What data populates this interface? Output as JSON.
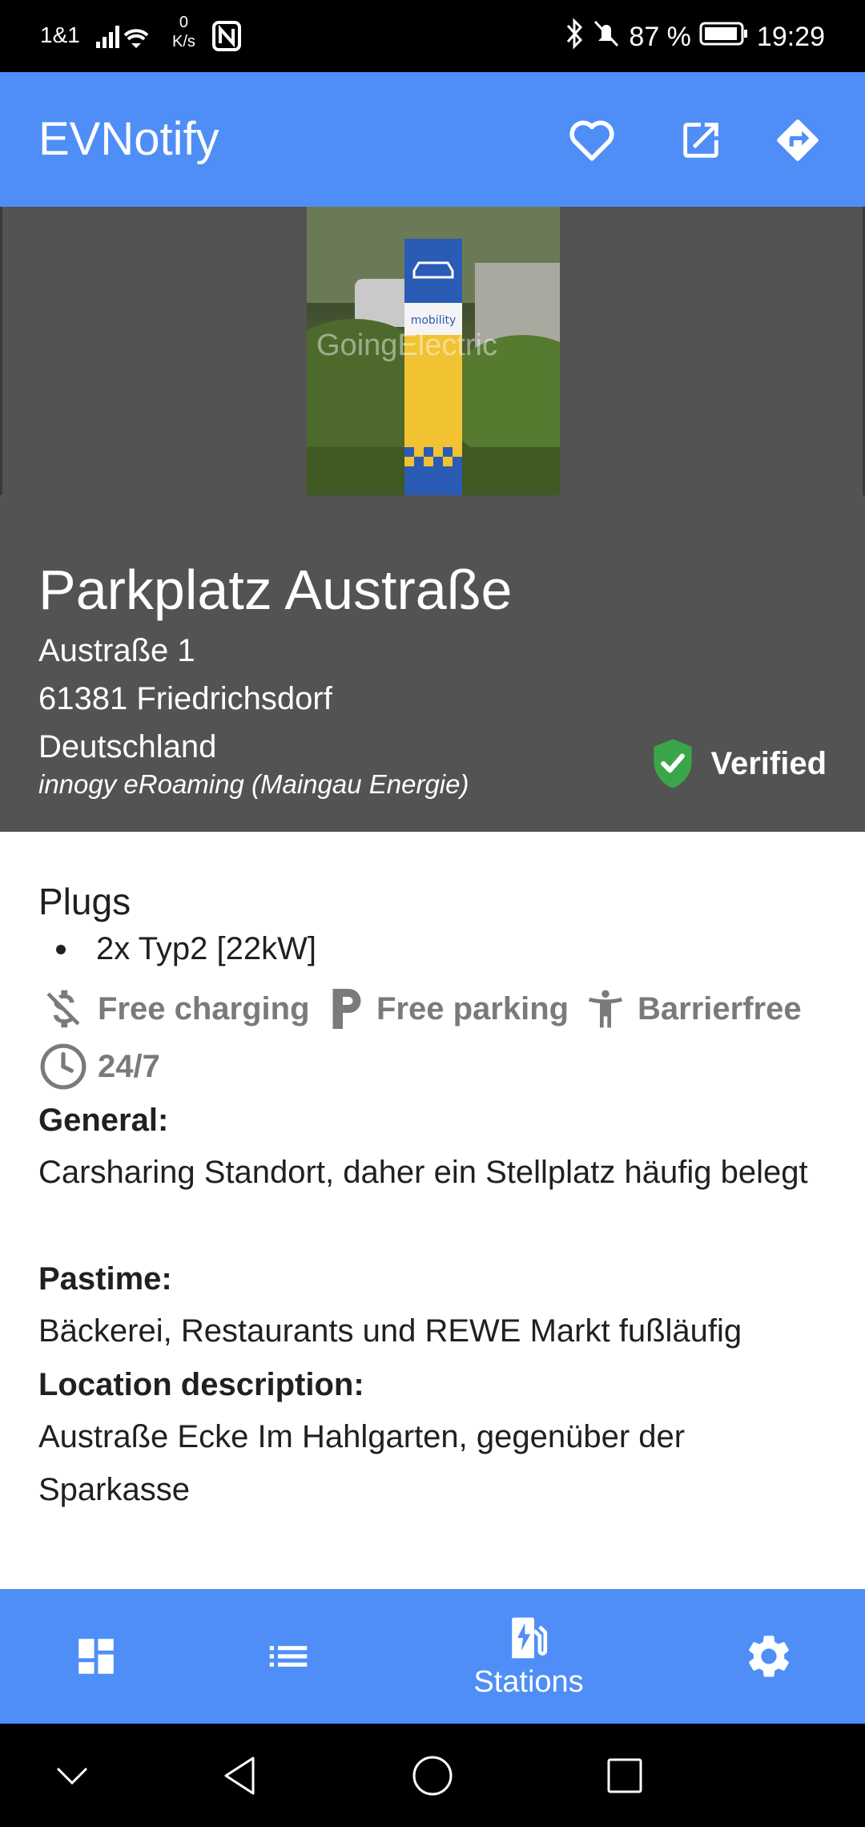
{
  "status_bar": {
    "carrier": "1&1",
    "net_speed_value": "0",
    "net_speed_unit": "K/s",
    "battery": "87 %",
    "time": "19:29"
  },
  "app_bar": {
    "title": "EVNotify",
    "actions": [
      "heart-icon",
      "open-external-icon",
      "directions-icon"
    ]
  },
  "hero": {
    "photo_watermark": "GoingElectric",
    "station_name": "Parkplatz Austraße",
    "address_line1": "Austraße 1",
    "address_line2": "61381 Friedrichsdorf",
    "address_line3": "Deutschland",
    "operator": "innogy eRoaming (Maingau Energie)",
    "verified_label": "Verified",
    "colors": {
      "background": "#535353",
      "verified_shield": "#3aa64a"
    }
  },
  "details": {
    "plugs_title": "Plugs",
    "plugs": [
      "2x Typ2 [22kW]"
    ],
    "features": {
      "free_charging": "Free charging",
      "free_parking": "Free parking",
      "barrierfree": "Barrierfree",
      "open_hours": "24/7"
    },
    "general_label": "General:",
    "general_text": "Carsharing Standort, daher ein Stellplatz häufig belegt",
    "pastime_label": "Pastime:",
    "pastime_text": "Bäckerei, Restaurants und REWE Markt fußläufig",
    "location_label": "Location description:",
    "location_text": "Austraße Ecke Im Hahlgarten, gegenüber der Sparkasse"
  },
  "bottom_nav": {
    "items": [
      {
        "icon": "dashboard-icon",
        "label": ""
      },
      {
        "icon": "list-icon",
        "label": ""
      },
      {
        "icon": "ev-station-icon",
        "label": "Stations"
      },
      {
        "icon": "settings-icon",
        "label": ""
      }
    ],
    "active": "Stations",
    "color": "#4f8ef7"
  }
}
